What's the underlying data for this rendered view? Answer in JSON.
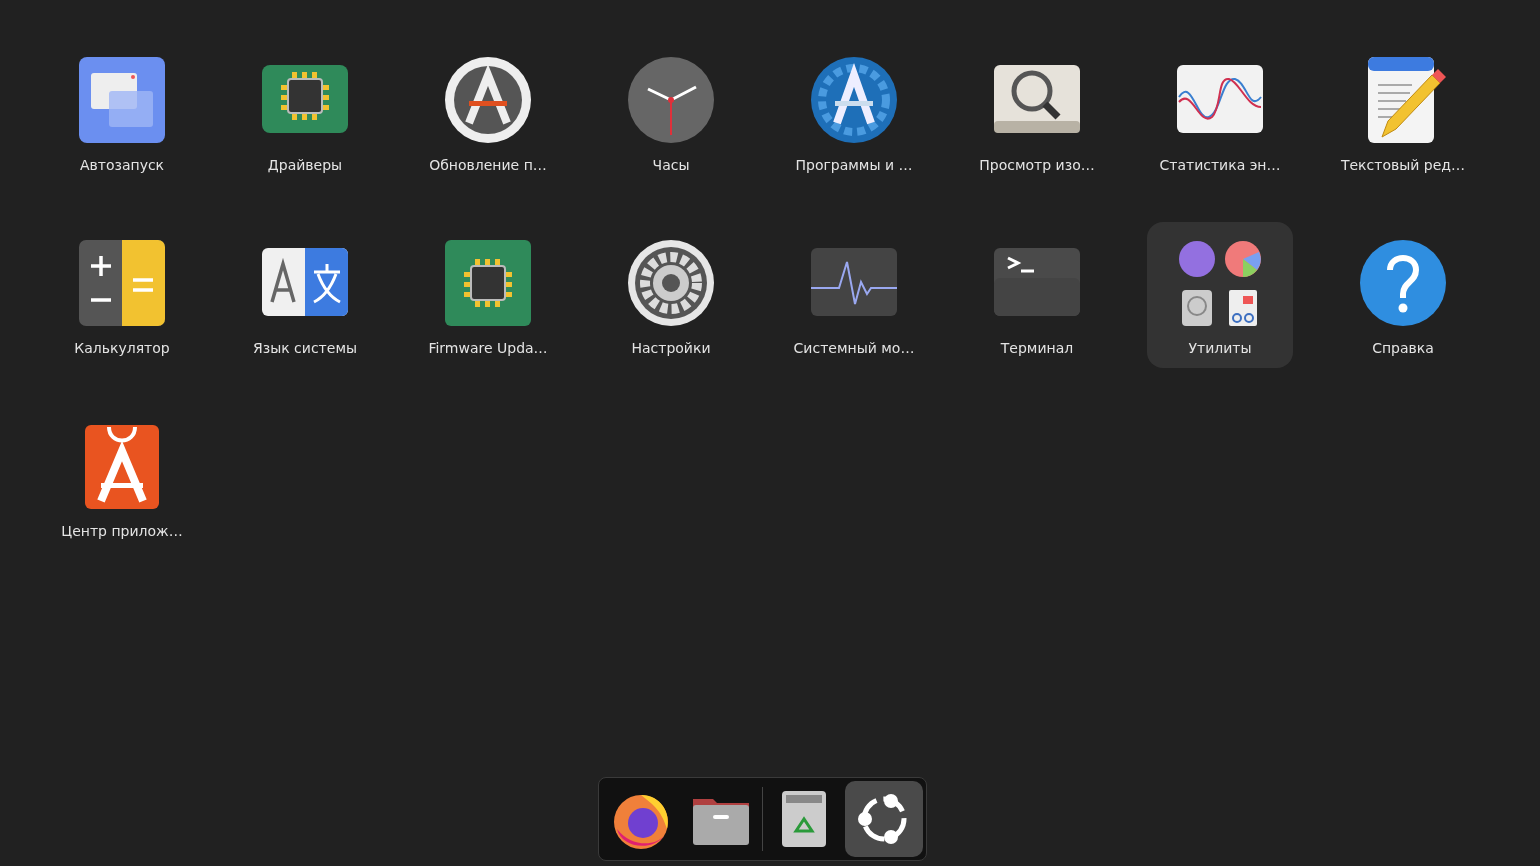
{
  "apps": [
    {
      "label": "Автозапуск",
      "kind": "app"
    },
    {
      "label": "Драйверы",
      "kind": "app"
    },
    {
      "label": "Обновление п…",
      "kind": "app"
    },
    {
      "label": "Часы",
      "kind": "app"
    },
    {
      "label": "Программы и …",
      "kind": "app"
    },
    {
      "label": "Просмотр изо…",
      "kind": "app"
    },
    {
      "label": "Статистика эн…",
      "kind": "app"
    },
    {
      "label": "Текстовый ред…",
      "kind": "app"
    },
    {
      "label": "Калькулятор",
      "kind": "app"
    },
    {
      "label": "Язык системы",
      "kind": "app"
    },
    {
      "label": "Firmware Upda…",
      "kind": "app"
    },
    {
      "label": "Настройки",
      "kind": "app"
    },
    {
      "label": "Системный мо…",
      "kind": "app"
    },
    {
      "label": "Терминал",
      "kind": "app"
    },
    {
      "label": "Утилиты",
      "kind": "folder"
    },
    {
      "label": "Справка",
      "kind": "app"
    },
    {
      "label": "Центр прилож…",
      "kind": "app"
    }
  ],
  "dock": [
    {
      "selected": false
    },
    {
      "selected": false
    },
    {
      "selected": false
    },
    {
      "selected": true
    }
  ]
}
